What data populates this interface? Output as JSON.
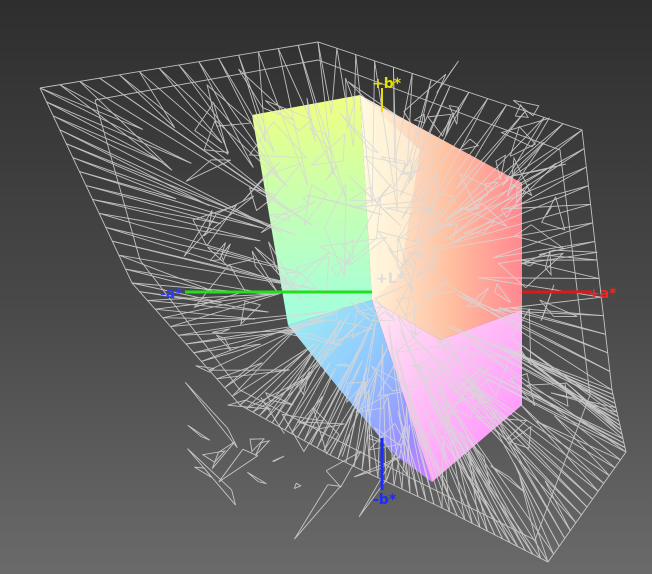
{
  "axes": {
    "plus_b": {
      "label": "+b*",
      "color": "#e8e000"
    },
    "minus_b": {
      "label": "-b*",
      "color": "#1a2cff"
    },
    "plus_a": {
      "label": "+a*",
      "color": "#ff2020"
    },
    "minus_a": {
      "label": "-a*",
      "color": "#2a3cff"
    },
    "plus_L": {
      "label": "+L*",
      "color": "#dcdcdc"
    }
  },
  "colors": {
    "green_axis": "#20e020",
    "red_axis": "#e01818",
    "blue_axis": "#1a2cff",
    "wireframe": "#d8d8d8"
  }
}
